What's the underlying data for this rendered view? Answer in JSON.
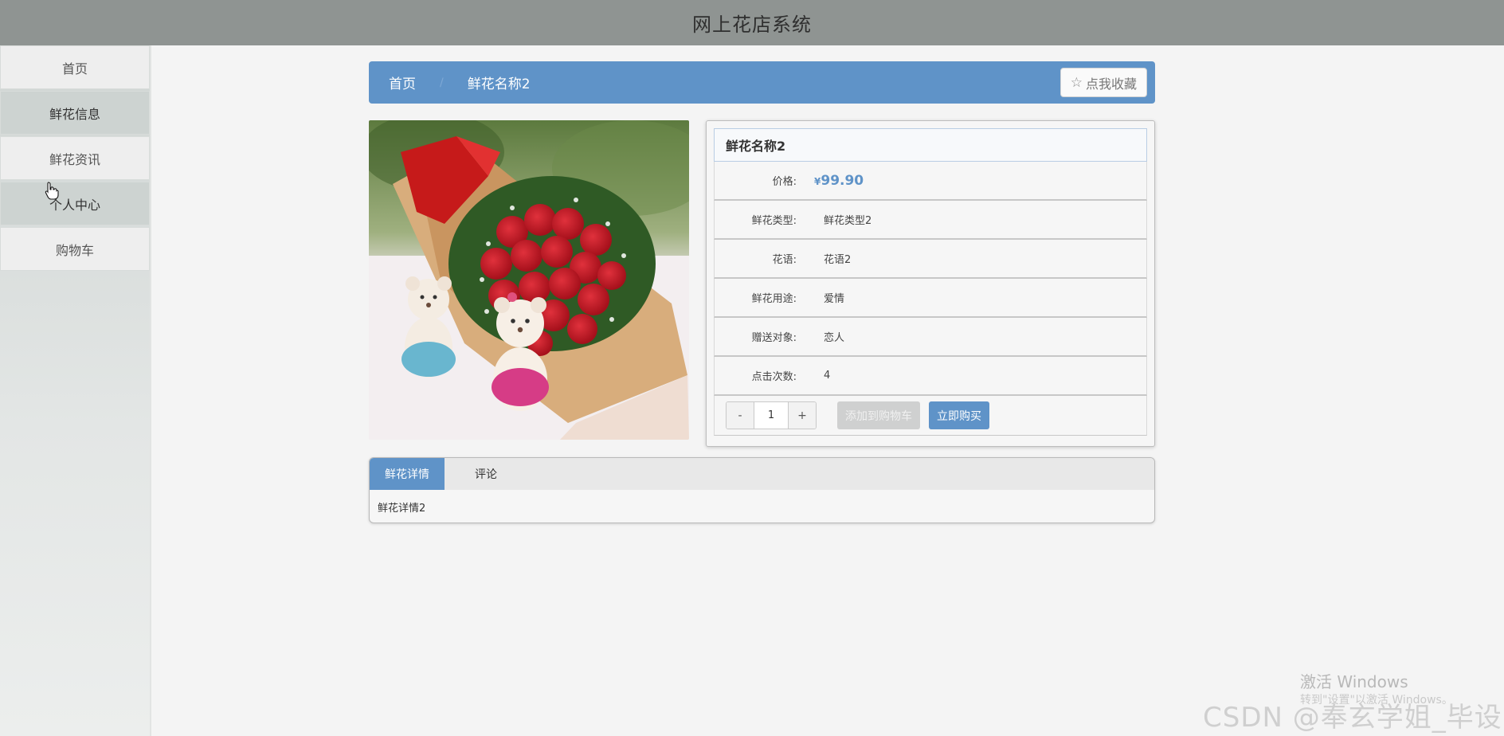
{
  "app": {
    "title": "网上花店系统"
  },
  "sidebar": {
    "items": [
      {
        "label": "首页"
      },
      {
        "label": "鲜花信息"
      },
      {
        "label": "鲜花资讯"
      },
      {
        "label": "个人中心"
      },
      {
        "label": "购物车"
      }
    ]
  },
  "breadcrumb": {
    "home": "首页",
    "current": "鲜花名称2",
    "separator": "/"
  },
  "favorite": {
    "label": "点我收藏",
    "icon": "star-outline-icon"
  },
  "product": {
    "name": "鲜花名称2",
    "price_label": "价格:",
    "currency": "¥",
    "price": "99.90",
    "fields": [
      {
        "label": "鲜花类型:",
        "value": "鲜花类型2"
      },
      {
        "label": "花语:",
        "value": "花语2"
      },
      {
        "label": "鲜花用途:",
        "value": "爱情"
      },
      {
        "label": "赠送对象:",
        "value": "恋人"
      },
      {
        "label": "点击次数:",
        "value": "4"
      }
    ],
    "quantity": "1",
    "minus_label": "-",
    "plus_label": "+",
    "add_to_cart_label": "添加到购物车",
    "buy_now_label": "立即购买"
  },
  "tabs": {
    "items": [
      {
        "label": "鲜花详情"
      },
      {
        "label": "评论"
      }
    ],
    "active_content": "鲜花详情2"
  },
  "watermark": {
    "activate_title": "激活 Windows",
    "activate_sub": "转到\"设置\"以激活 Windows。",
    "csdn": "CSDN @奉玄学姐_毕设"
  },
  "colors": {
    "accent": "#5f93c8",
    "header_bg": "#8f9492"
  }
}
